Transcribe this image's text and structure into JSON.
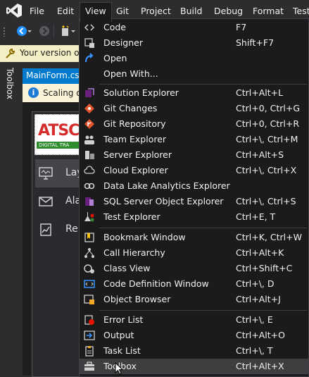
{
  "menubar": {
    "items": [
      "File",
      "Edit",
      "View",
      "Git",
      "Project",
      "Build",
      "Debug",
      "Format",
      "Test"
    ],
    "active": "View"
  },
  "toolbar": {
    "icons": [
      "back-icon",
      "forward-icon",
      "new-item-icon"
    ]
  },
  "infobar": {
    "text": "Your version of"
  },
  "side_tab": {
    "label": "Toolbox"
  },
  "document_tab": {
    "label": "MainForm.cs ["
  },
  "scaling_bar": {
    "text": "Scaling o"
  },
  "designer": {
    "logo_text": "ATSC",
    "logo_subtitle": "DIGITAL TRA",
    "nav": [
      {
        "label": "Lay",
        "icon": "monitor-icon"
      },
      {
        "label": "Ala",
        "icon": "mail-icon"
      },
      {
        "label": "Re",
        "icon": "report-icon"
      }
    ]
  },
  "view_menu": {
    "groups": [
      [
        {
          "label": "Code",
          "shortcut": "F7",
          "icon": "code-icon"
        },
        {
          "label": "Designer",
          "shortcut": "Shift+F7",
          "icon": "designer-icon"
        },
        {
          "label": "Open",
          "shortcut": "",
          "icon": "open-icon"
        },
        {
          "label": "Open With...",
          "shortcut": "",
          "icon": ""
        }
      ],
      [
        {
          "label": "Solution Explorer",
          "shortcut": "Ctrl+Alt+L",
          "icon": "solution-explorer-icon"
        },
        {
          "label": "Git Changes",
          "shortcut": "Ctrl+0, Ctrl+G",
          "icon": "git-changes-icon"
        },
        {
          "label": "Git Repository",
          "shortcut": "Ctrl+0, Ctrl+R",
          "icon": "git-repository-icon"
        },
        {
          "label": "Team Explorer",
          "shortcut": "Ctrl+\\, Ctrl+M",
          "icon": "team-explorer-icon"
        },
        {
          "label": "Server Explorer",
          "shortcut": "Ctrl+Alt+S",
          "icon": "server-explorer-icon"
        },
        {
          "label": "Cloud Explorer",
          "shortcut": "Ctrl+\\, Ctrl+X",
          "icon": "cloud-icon"
        },
        {
          "label": "Data Lake Analytics Explorer",
          "shortcut": "",
          "icon": "data-lake-icon"
        },
        {
          "label": "SQL Server Object Explorer",
          "shortcut": "Ctrl+\\, Ctrl+S",
          "icon": "sql-server-icon"
        },
        {
          "label": "Test Explorer",
          "shortcut": "Ctrl+E, T",
          "icon": "test-explorer-icon"
        }
      ],
      [
        {
          "label": "Bookmark Window",
          "shortcut": "Ctrl+K, Ctrl+W",
          "icon": "bookmark-icon"
        },
        {
          "label": "Call Hierarchy",
          "shortcut": "Ctrl+Alt+K",
          "icon": "call-hierarchy-icon"
        },
        {
          "label": "Class View",
          "shortcut": "Ctrl+Shift+C",
          "icon": "class-view-icon"
        },
        {
          "label": "Code Definition Window",
          "shortcut": "Ctrl+\\, D",
          "icon": "code-definition-icon"
        },
        {
          "label": "Object Browser",
          "shortcut": "Ctrl+Alt+J",
          "icon": "object-browser-icon"
        }
      ],
      [
        {
          "label": "Error List",
          "shortcut": "Ctrl+\\, E",
          "icon": "error-list-icon"
        },
        {
          "label": "Output",
          "shortcut": "Ctrl+Alt+O",
          "icon": "output-icon"
        },
        {
          "label": "Task List",
          "shortcut": "Ctrl+\\, T",
          "icon": "task-list-icon"
        },
        {
          "label": "Toolbox",
          "shortcut": "Ctrl+Alt+X",
          "icon": "toolbox-icon"
        }
      ]
    ],
    "hovered": "Toolbox"
  },
  "colors": {
    "accent": "#007acc",
    "menu_bg": "#1b1b1c",
    "chrome_bg": "#2d2d30",
    "infobar_bg": "#f4eec4"
  }
}
